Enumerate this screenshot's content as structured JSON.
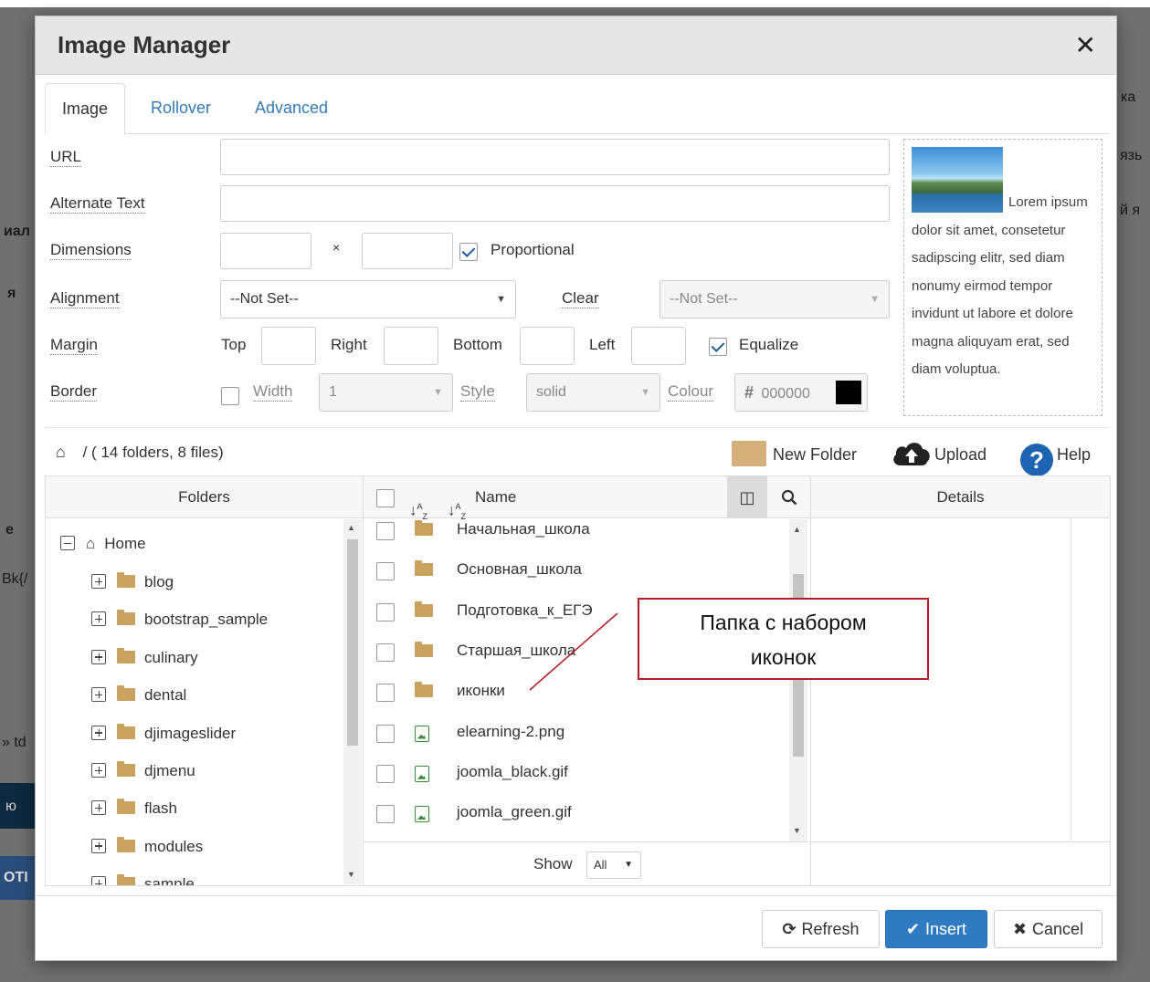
{
  "dialog": {
    "title": "Image Manager",
    "close_glyph": "✕"
  },
  "tabs": [
    {
      "label": "Image",
      "active": true
    },
    {
      "label": "Rollover",
      "active": false
    },
    {
      "label": "Advanced",
      "active": false
    }
  ],
  "form": {
    "url_label": "URL",
    "url_value": "",
    "alt_label": "Alternate Text",
    "alt_value": "",
    "dimensions_label": "Dimensions",
    "dimensions_separator": "×",
    "width_value": "",
    "height_value": "",
    "proportional_label": "Proportional",
    "proportional_checked": true,
    "alignment_label": "Alignment",
    "alignment_value": "--Not Set--",
    "clear_label": "Clear",
    "clear_value": "--Not Set--",
    "margin_label": "Margin",
    "margin_top_label": "Top",
    "margin_right_label": "Right",
    "margin_bottom_label": "Bottom",
    "margin_left_label": "Left",
    "equalize_label": "Equalize",
    "equalize_checked": true,
    "border_label": "Border",
    "border_checked": false,
    "border_width_label": "Width",
    "border_width_value": "1",
    "border_style_label": "Style",
    "border_style_value": "solid",
    "border_colour_label": "Colour",
    "border_colour_hash": "#",
    "border_colour_value": "000000",
    "border_colour_swatch": "#000000"
  },
  "preview": {
    "text": "Lorem ipsum dolor sit amet, consetetur sadipscing elitr, sed diam nonumy eirmod tempor invidunt ut labore et dolore magna aliquyam erat, sed diam voluptua."
  },
  "toolbar": {
    "path": "/ ( 14 folders, 8 files)",
    "new_folder": "New Folder",
    "upload": "Upload",
    "help": "Help"
  },
  "folders_pane": {
    "header": "Folders",
    "root": "Home",
    "items": [
      "blog",
      "bootstrap_sample",
      "culinary",
      "dental",
      "djimageslider",
      "djmenu",
      "flash",
      "modules",
      "sample"
    ]
  },
  "files_pane": {
    "name_header": "Name",
    "items": [
      {
        "name": "Начальная_школа",
        "type": "folder"
      },
      {
        "name": "Основная_школа",
        "type": "folder"
      },
      {
        "name": "Подготовка_к_ЕГЭ",
        "type": "folder"
      },
      {
        "name": "Старшая_школа",
        "type": "folder"
      },
      {
        "name": "иконки",
        "type": "folder"
      },
      {
        "name": "elearning-2.png",
        "type": "image"
      },
      {
        "name": "joomla_black.gif",
        "type": "image"
      },
      {
        "name": "joomla_green.gif",
        "type": "image"
      }
    ],
    "show_label": "Show",
    "show_value": "All"
  },
  "details_pane": {
    "header": "Details"
  },
  "footer": {
    "refresh": "Refresh",
    "insert": "Insert",
    "cancel": "Cancel"
  },
  "annotation": {
    "line1": "Папка с набором",
    "line2": "иконок"
  },
  "background_fragments": [
    "ка",
    "язь",
    "й я",
    "иал",
    "я",
    "е",
    "Вk{/",
    "» td",
    "ю",
    "ОТІ"
  ],
  "colors": {
    "accent": "#2f7bc1",
    "link": "#337ab7",
    "folder": "#c9a25e",
    "callout_border": "#b01e2a"
  }
}
